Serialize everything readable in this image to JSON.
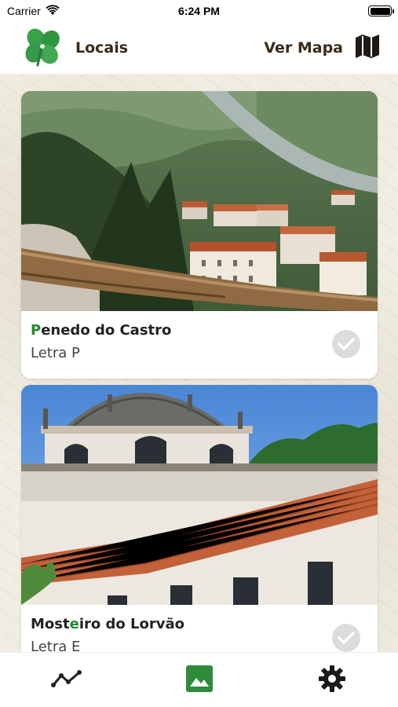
{
  "status_bar": {
    "carrier": "Carrier",
    "time": "6:24 PM",
    "icons": [
      "wifi-icon",
      "battery-icon"
    ]
  },
  "nav": {
    "logo_icon": "clover-icon",
    "title": "Locais",
    "right_label": "Ver Mapa",
    "right_icon": "map-icon"
  },
  "locations": [
    {
      "title_first": "P",
      "title_rest": "enedo do Castro",
      "subtitle": "Letra P",
      "image": "valley-town-photo",
      "visited_icon": "check-circle-icon"
    },
    {
      "title_first": "Mosteiro",
      "title_highlight": "e",
      "title_rest_a": "Most",
      "title_rest_b": "iro do Lorvão",
      "subtitle": "Letra E",
      "image": "monastery-photo",
      "visited_icon": "check-circle-icon"
    }
  ],
  "tab_bar": {
    "tabs": [
      {
        "icon": "route-icon"
      },
      {
        "icon": "gallery-icon",
        "active": true
      },
      {
        "icon": "settings-icon"
      }
    ]
  },
  "colors": {
    "accent_green": "#1f8a2a",
    "title_brown": "#3b2a1a",
    "tab_active": "#2e8b3a"
  }
}
